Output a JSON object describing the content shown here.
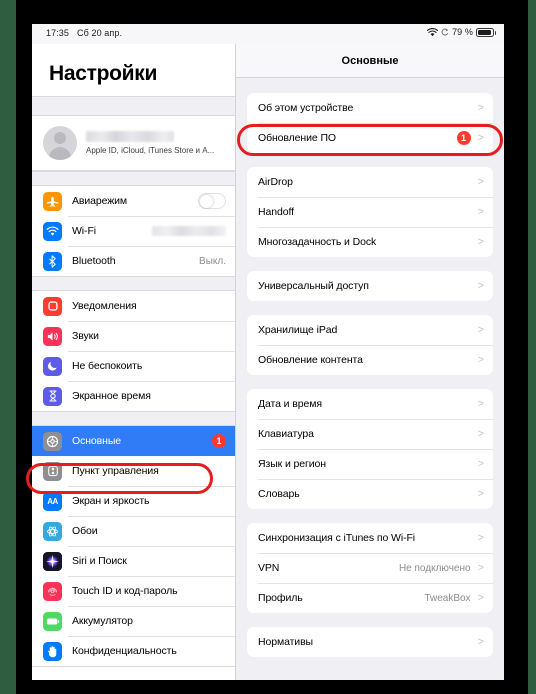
{
  "status_bar": {
    "time": "17:35",
    "date": "Сб 20 апр.",
    "battery_percent": "79 %",
    "wifi_icon": "wifi-icon",
    "rotation_lock_icon": "rotation-lock-icon",
    "battery_icon": "battery-icon"
  },
  "sidebar": {
    "title": "Настройки",
    "apple_id": {
      "name": "",
      "subtitle": "Apple ID, iCloud, iTunes Store и A..."
    },
    "groups": [
      {
        "items": [
          {
            "label": "Авиарежим",
            "icon": "airplane-icon",
            "icon_color": "#ff9500",
            "accessory": "toggle",
            "toggle_on": false
          },
          {
            "label": "Wi-Fi",
            "icon": "wifi-icon",
            "icon_color": "#007aff",
            "accessory": "blurred-value"
          },
          {
            "label": "Bluetooth",
            "icon": "bluetooth-icon",
            "icon_color": "#007aff",
            "accessory": "value",
            "value": "Выкл."
          }
        ]
      },
      {
        "items": [
          {
            "label": "Уведомления",
            "icon": "notifications-icon",
            "icon_color": "#ff3b30",
            "accessory": "none"
          },
          {
            "label": "Звуки",
            "icon": "sounds-icon",
            "icon_color": "#fc3158",
            "accessory": "none"
          },
          {
            "label": "Не беспокоить",
            "icon": "do-not-disturb-icon",
            "icon_color": "#5856d6",
            "accessory": "none"
          },
          {
            "label": "Экранное время",
            "icon": "screen-time-icon",
            "icon_color": "#5856d6",
            "accessory": "none"
          }
        ]
      },
      {
        "items": [
          {
            "label": "Основные",
            "icon": "gear-icon",
            "icon_color": "#8e8e93",
            "accessory": "badge",
            "badge": "1",
            "selected": true
          },
          {
            "label": "Пункт управления",
            "icon": "control-center-icon",
            "icon_color": "#8e8e93",
            "accessory": "none"
          },
          {
            "label": "Экран и яркость",
            "icon": "display-brightness-icon",
            "icon_color": "#007aff",
            "accessory": "none"
          },
          {
            "label": "Обои",
            "icon": "wallpaper-icon",
            "icon_color": "#34aadc",
            "accessory": "none"
          },
          {
            "label": "Siri и Поиск",
            "icon": "siri-icon",
            "icon_color": "#1c1c2e",
            "accessory": "none"
          },
          {
            "label": "Touch ID и код-пароль",
            "icon": "touch-id-icon",
            "icon_color": "#fc3158",
            "accessory": "none"
          },
          {
            "label": "Аккумулятор",
            "icon": "battery-icon",
            "icon_color": "#4cd964",
            "accessory": "none"
          },
          {
            "label": "Конфиденциальность",
            "icon": "privacy-hand-icon",
            "icon_color": "#007aff",
            "accessory": "none"
          }
        ]
      }
    ]
  },
  "detail": {
    "title": "Основные",
    "groups": [
      {
        "rows": [
          {
            "label": "Об этом устройстве",
            "chevron": ">"
          },
          {
            "label": "Обновление ПО",
            "badge": "1",
            "chevron": ">",
            "highlighted": true
          }
        ]
      },
      {
        "rows": [
          {
            "label": "AirDrop",
            "chevron": ">"
          },
          {
            "label": "Handoff",
            "chevron": ">"
          },
          {
            "label": "Многозадачность и Dock",
            "chevron": ">"
          }
        ]
      },
      {
        "rows": [
          {
            "label": "Универсальный доступ",
            "chevron": ">"
          }
        ]
      },
      {
        "rows": [
          {
            "label": "Хранилище iPad",
            "chevron": ">"
          },
          {
            "label": "Обновление контента",
            "chevron": ">"
          }
        ]
      },
      {
        "rows": [
          {
            "label": "Дата и время",
            "chevron": ">"
          },
          {
            "label": "Клавиатура",
            "chevron": ">"
          },
          {
            "label": "Язык и регион",
            "chevron": ">"
          },
          {
            "label": "Словарь",
            "chevron": ">"
          }
        ]
      },
      {
        "rows": [
          {
            "label": "Синхронизация с iTunes по Wi-Fi",
            "chevron": ">"
          },
          {
            "label": "VPN",
            "value": "Не подключено",
            "chevron": ">"
          },
          {
            "label": "Профиль",
            "value": "TweakBox",
            "chevron": ">"
          }
        ]
      },
      {
        "rows": [
          {
            "label": "Нормативы",
            "chevron": ">"
          }
        ]
      }
    ]
  },
  "annotations": {
    "color": "#e81c1c",
    "shapes": [
      "oval-around-software-update-row",
      "oval-around-general-sidebar-row"
    ]
  }
}
